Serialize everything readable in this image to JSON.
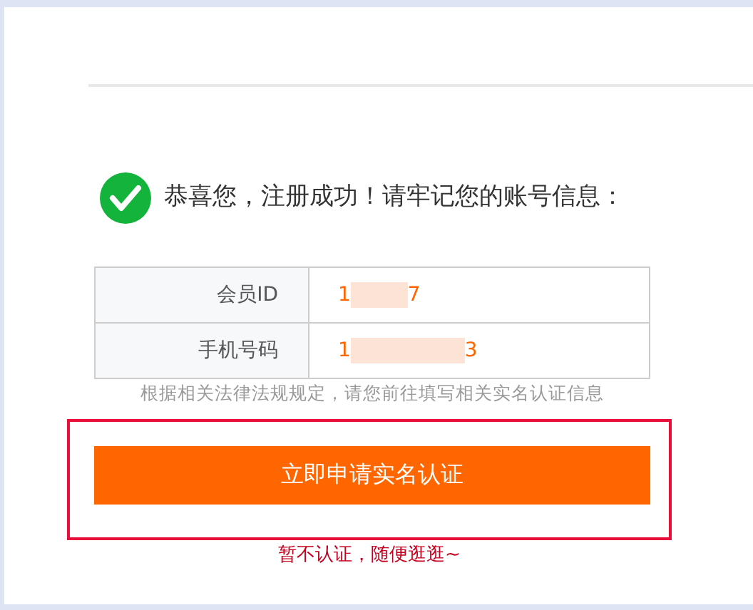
{
  "heading": "恭喜您，注册成功！请牢记您的账号信息：",
  "account_rows": [
    {
      "label": "会员ID",
      "value_start": "1",
      "value_end": "7"
    },
    {
      "label": "手机号码",
      "value_start": "1",
      "value_end": "3"
    }
  ],
  "notice": "根据相关法律法规规定，请您前往填写相关实名认证信息",
  "verify_button": "立即申请实名认证",
  "skip_link": "暂不认证，随便逛逛~"
}
